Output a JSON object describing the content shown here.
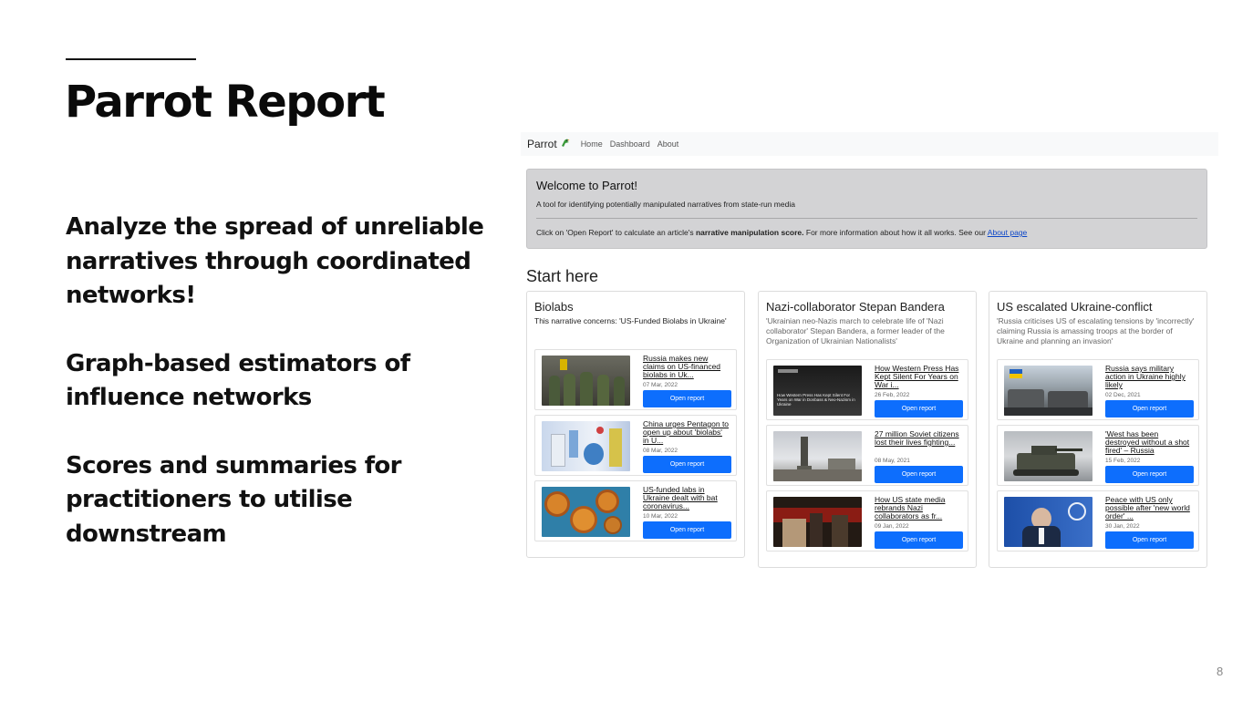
{
  "slide": {
    "title": "Parrot Report",
    "bullets": [
      "Analyze the spread of unreliable\nnarratives through coordinated\nnetworks!",
      "Graph-based estimators of\ninfluence networks",
      "Scores and summaries for\npractitioners to utilise downstream"
    ],
    "page_number": "8"
  },
  "app": {
    "brand": "Parrot",
    "brand_icon": "parrot-icon",
    "nav": [
      "Home",
      "Dashboard",
      "About"
    ],
    "welcome": {
      "title": "Welcome to Parrot!",
      "subtitle": "A tool for identifying potentially manipulated narratives from state-run media",
      "text_before": "Click on 'Open Report' to calculate an article's ",
      "text_bold": "narrative manipulation score.",
      "text_after": " For more information about how it all works. See our ",
      "link": "About page"
    },
    "start_title": "Start here",
    "button_label": "Open report",
    "topics": [
      {
        "title": "Biolabs",
        "description": "This narrative concerns: 'US-Funded Biolabs in Ukraine'",
        "articles": [
          {
            "title": "Russia makes new claims on US-financed biolabs in Uk...",
            "date": "07 Mar, 2022"
          },
          {
            "title": "China urges Pentagon to open up about 'biolabs' in U...",
            "date": "08 Mar, 2022"
          },
          {
            "title": "US-funded labs in Ukraine dealt with bat coronavirus...",
            "date": "10 Mar, 2022"
          }
        ]
      },
      {
        "title": "Nazi-collaborator Stepan Bandera",
        "description": "'Ukrainian neo-Nazis march to celebrate life of 'Nazi collaborator' Stepan Bandera, a former leader of the Organization of Ukrainian Nationalists'",
        "articles": [
          {
            "title": "How Western Press Has Kept Silent For Years on War i...",
            "date": "26 Feb, 2022",
            "thumb_caption": "How Western Press Has Kept Silent For Years on War in Donbass & Neo-Nazism in Ukraine"
          },
          {
            "title": "27 million Soviet citizens lost their lives fighting...",
            "date": "08 May, 2021"
          },
          {
            "title": "How US state media rebrands Nazi collaborators as fr...",
            "date": "09 Jan, 2022"
          }
        ]
      },
      {
        "title": "US escalated Ukraine-conflict",
        "description": "'Russia criticises US of escalating tensions by 'incorrectly' claiming Russia is amassing troops at the border of Ukraine and planning an invasion'",
        "articles": [
          {
            "title": "Russia says military action in Ukraine highly likely",
            "date": "02 Dec, 2021"
          },
          {
            "title": "'West has been destroyed without a shot fired' – Russia",
            "date": "15 Feb, 2022"
          },
          {
            "title": "Peace with US only possible after 'new world order' ...",
            "date": "30 Jan, 2022"
          }
        ]
      }
    ]
  }
}
